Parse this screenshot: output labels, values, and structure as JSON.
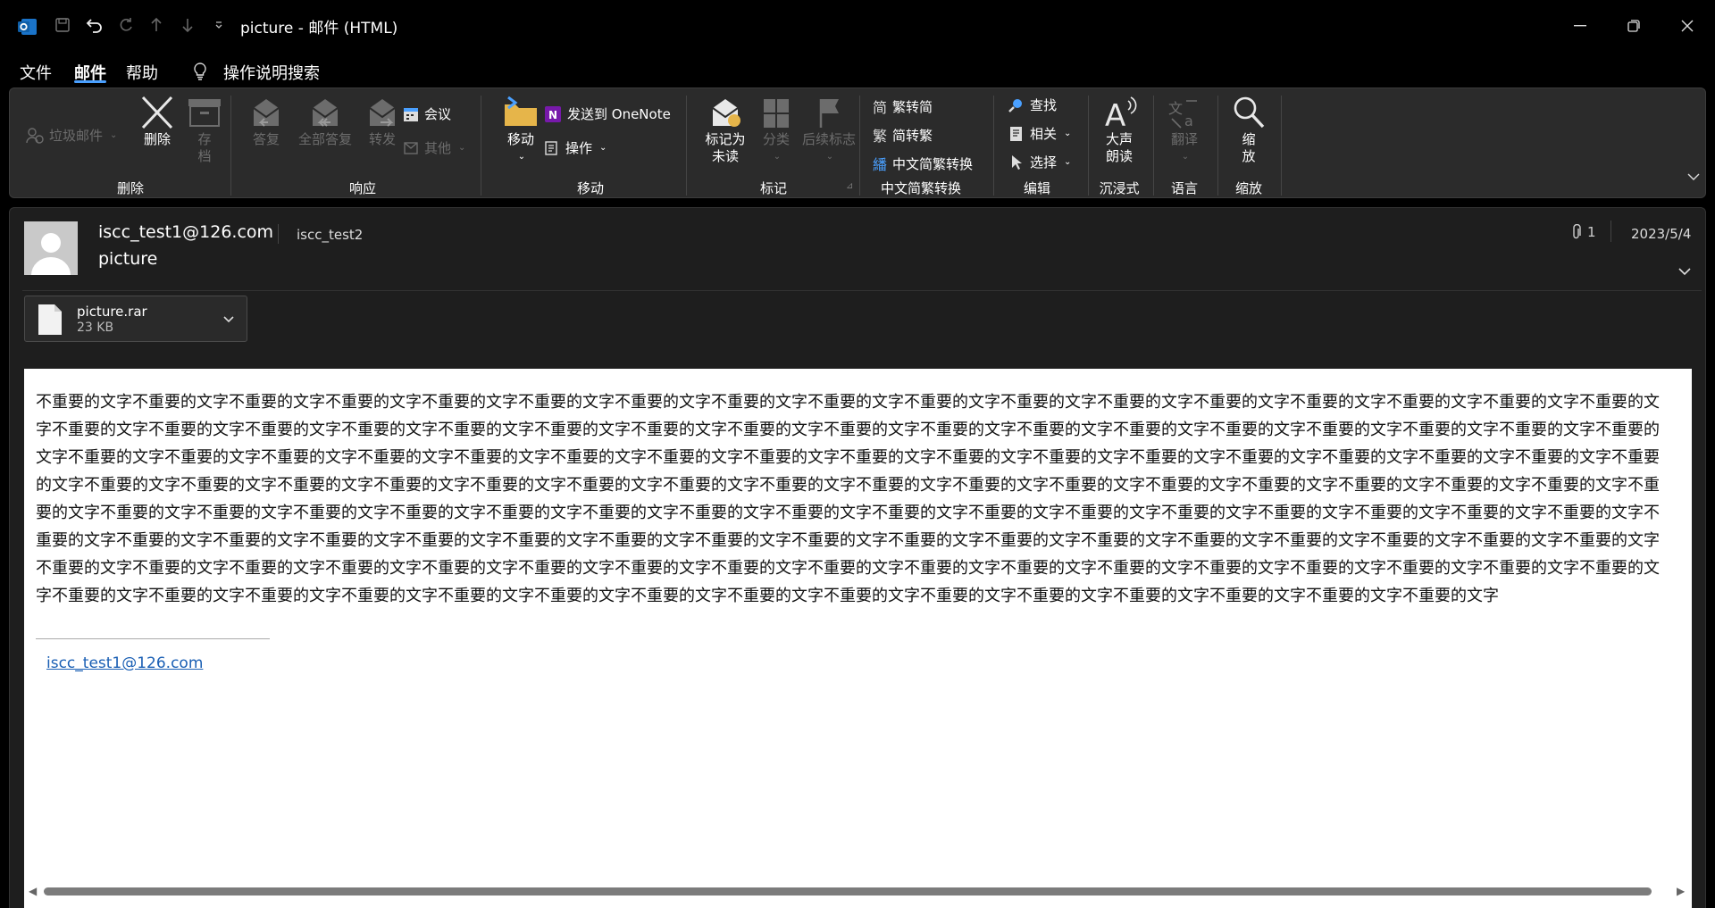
{
  "window": {
    "title": "picture - 邮件 (HTML)"
  },
  "menu": {
    "tabs": [
      "文件",
      "邮件",
      "帮助"
    ],
    "active_tab": "邮件",
    "search_label": "操作说明搜索"
  },
  "ribbon": {
    "delete_group": {
      "label": "删除",
      "junk": "垃圾邮件",
      "delete": "删除",
      "archive": "存\n档"
    },
    "respond_group": {
      "label": "响应",
      "reply": "答复",
      "reply_all": "全部答复",
      "forward": "转发",
      "meeting": "会议",
      "other": "其他"
    },
    "move_group": {
      "label": "移动",
      "move": "移动",
      "onenote": "发送到 OneNote",
      "actions": "操作"
    },
    "tags_group": {
      "label": "标记",
      "mark_unread": "标记为\n未读",
      "categorize": "分类",
      "follow_up": "后续标志"
    },
    "chinese_group": {
      "label": "中文简繁转换",
      "trad_to_simp": "繁转简",
      "simp_to_trad": "简转繁",
      "convert": "中文简繁转换"
    },
    "edit_group": {
      "label": "编辑",
      "find": "查找",
      "related": "相关",
      "select": "选择"
    },
    "immersive_group": {
      "label": "沉浸式",
      "read_aloud": "大声\n朗读"
    },
    "language_group": {
      "label": "语言",
      "translate": "翻译"
    },
    "zoom_group": {
      "label": "缩放",
      "zoom": "缩\n放"
    }
  },
  "message": {
    "sender": "iscc_test1@126.com",
    "recipient": "iscc_test2",
    "subject": "picture",
    "attachment_count": "1",
    "date": "2023/5/4",
    "attachment": {
      "name": "picture.rar",
      "size": "23 KB"
    },
    "body": "不重要的文字不重要的文字不重要的文字不重要的文字不重要的文字不重要的文字不重要的文字不重要的文字不重要的文字不重要的文字不重要的文字不重要的文字不重要的文字不重要的文字不重要的文字不重要的文字不重要的文字不重要的文字不重要的文字不重要的文字不重要的文字不重要的文字不重要的文字不重要的文字不重要的文字不重要的文字不重要的文字不重要的文字不重要的文字不重要的文字不重要的文字不重要的文字不重要的文字不重要的文字不重要的文字不重要的文字不重要的文字不重要的文字不重要的文字不重要的文字不重要的文字不重要的文字不重要的文字不重要的文字不重要的文字不重要的文字不重要的文字不重要的文字不重要的文字不重要的文字不重要的文字不重要的文字不重要的文字不重要的文字不重要的文字不重要的文字不重要的文字不重要的文字不重要的文字不重要的文字不重要的文字不重要的文字不重要的文字不重要的文字不重要的文字不重要的文字不重要的文字不重要的文字不重要的文字不重要的文字不重要的文字不重要的文字不重要的文字不重要的文字不重要的文字不重要的文字不重要的文字不重要的文字不重要的文字不重要的文字不重要的文字不重要的文字不重要的文字不重要的文字不重要的文字不重要的文字不重要的文字不重要的文字不重要的文字不重要的文字不重要的文字不重要的文字不重要的文字不重要的文字不重要的文字不重要的文字不重要的文字不重要的文字不重要的文字不重要的文字不重要的文字不重要的文字不重要的文字不重要的文字不重要的文字不重要的文字不重要的文字不重要的文字不重要的文字不重要的文字不重要的文字不重要的文字不重要的文字不重要的文字不重要的文字不重要的文字不重要的文字不重要的文字不重要的文字不重要的文字不重要的文字不重要的文字不重要的文字不重要的文字不重要的文字不重要的文字不重要的文字不重要的文字不重要的文字不重要的文字不重要的文字不重要的文字不重要的文字",
    "signature_link": "iscc_test1@126.com"
  },
  "colors": {
    "accent": "#4aa0ff",
    "link": "#1a5fb4",
    "ribbon_bg": "#2b2b2b",
    "window_bg": "#000000"
  }
}
